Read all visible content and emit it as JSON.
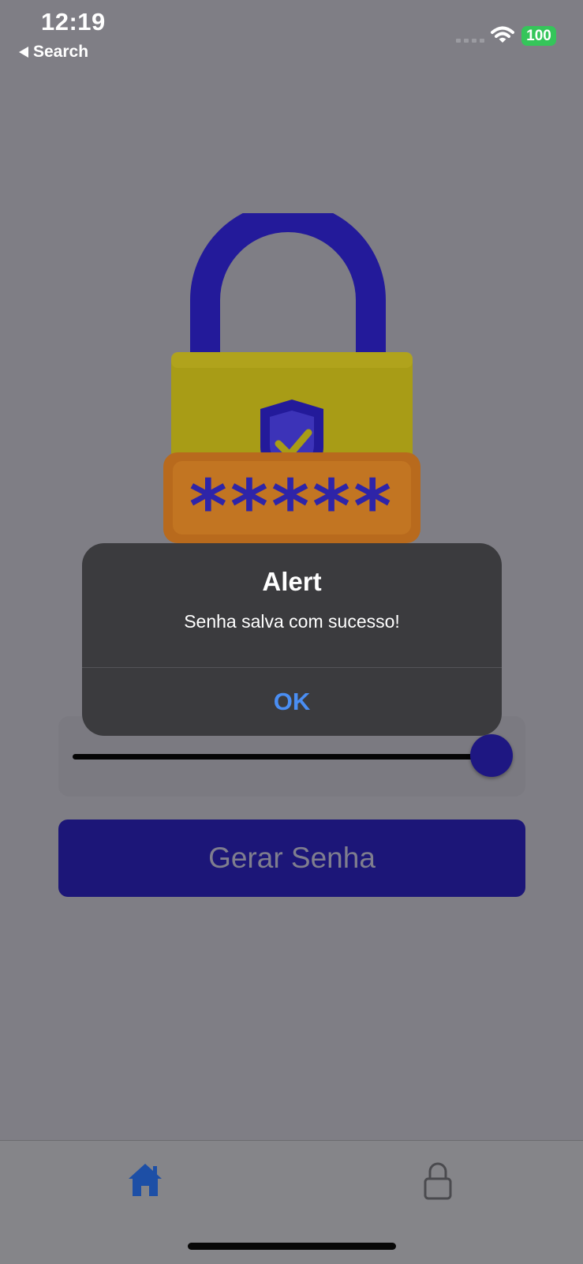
{
  "status_bar": {
    "time": "12:19",
    "back_label": "Search",
    "battery": "100"
  },
  "hero": {
    "icon": "padlock-password-icon",
    "masked_text": "*****"
  },
  "slider": {
    "value_fraction": 1.0
  },
  "primary_button": {
    "label": "Gerar Senha"
  },
  "alert": {
    "title": "Alert",
    "message": "Senha salva com sucesso!",
    "ok_label": "OK"
  },
  "tab_bar": {
    "items": [
      {
        "icon": "home-icon",
        "selected": true
      },
      {
        "icon": "lock-icon",
        "selected": false
      }
    ]
  },
  "colors": {
    "accent": "#1c1678",
    "alert_button": "#4a8ef3",
    "home_tab": "#1d4fa6"
  }
}
